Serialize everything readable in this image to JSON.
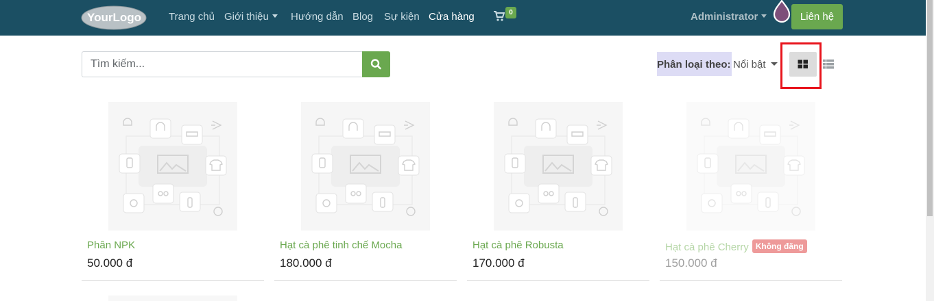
{
  "header": {
    "logo_text": "YourLogo",
    "nav": [
      "Trang chủ",
      "Giới thiệu",
      "Hướng dẫn",
      "Blog",
      "Sự kiện",
      "Cửa hàng"
    ],
    "cart_count": "0",
    "user": "Administrator",
    "contact_label": "Liên hệ",
    "colors": {
      "bar": "#1b4f63",
      "accent": "#6aa84f"
    }
  },
  "toolbar": {
    "search_placeholder": "Tìm kiếm...",
    "search_icon": "search-icon",
    "sort_label": "Phân loại theo:",
    "sort_value": "Nổi bật",
    "view_grid_icon": "grid-view-icon",
    "view_list_icon": "list-view-icon",
    "highlight_color": "#e8141c"
  },
  "products": [
    {
      "name": "Phân NPK",
      "price": "50.000 đ",
      "badge": ""
    },
    {
      "name": "Hạt cà phê tinh chế Mocha",
      "price": "180.000 đ",
      "badge": ""
    },
    {
      "name": "Hạt cà phê Robusta",
      "price": "170.000 đ",
      "badge": ""
    },
    {
      "name": "Hạt cà phê Cherry",
      "price": "150.000 đ",
      "badge": "Không đăng"
    }
  ]
}
